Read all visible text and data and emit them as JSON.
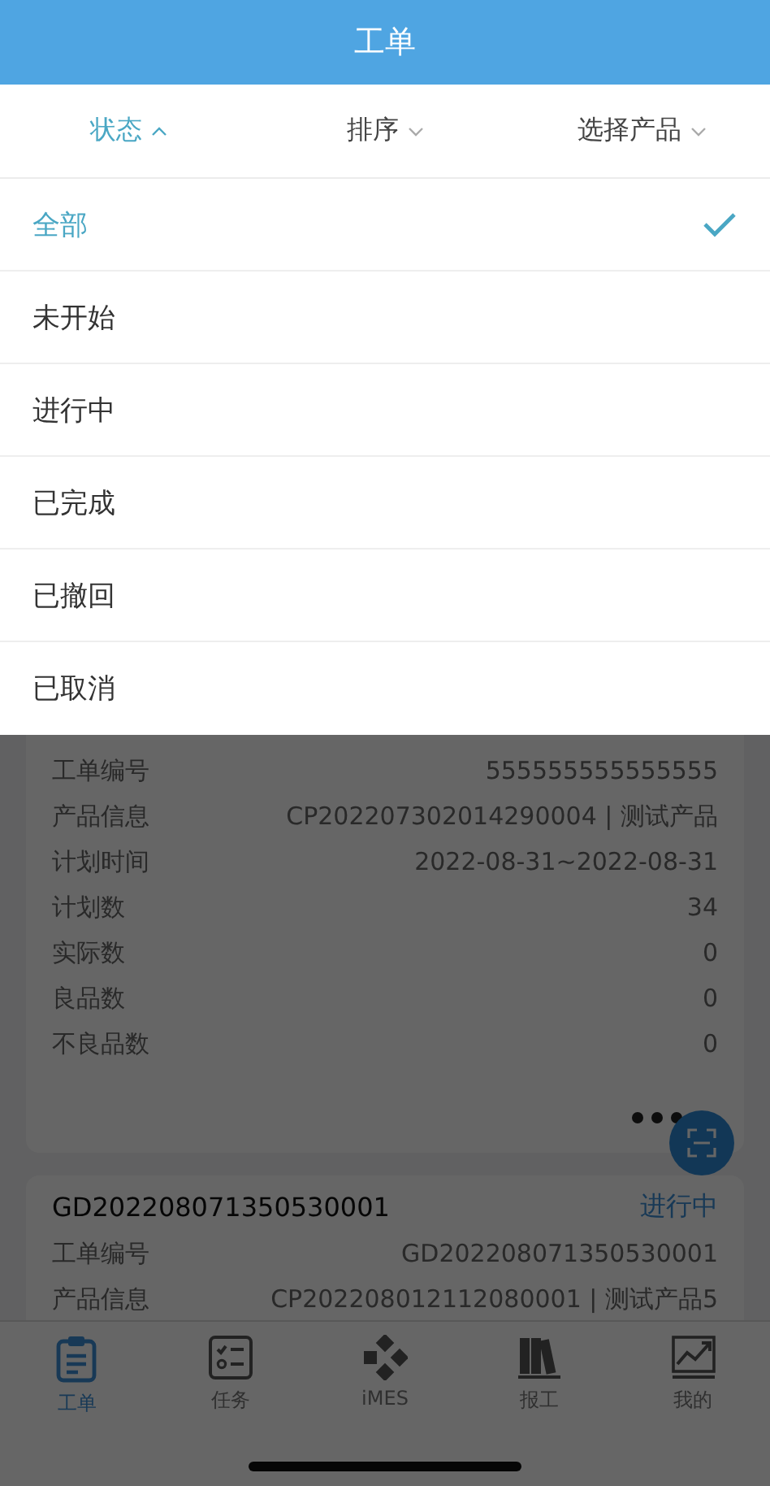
{
  "title": "工单",
  "filters": [
    {
      "label": "状态",
      "selected": true,
      "expanded": true
    },
    {
      "label": "排序",
      "selected": false,
      "expanded": false
    },
    {
      "label": "选择产品",
      "selected": false,
      "expanded": false
    }
  ],
  "status_menu": [
    {
      "label": "全部",
      "selected": true
    },
    {
      "label": "未开始",
      "selected": false
    },
    {
      "label": "进行中",
      "selected": false
    },
    {
      "label": "已完成",
      "selected": false
    },
    {
      "label": "已撤回",
      "selected": false
    },
    {
      "label": "已取消",
      "selected": false
    }
  ],
  "work_orders": [
    {
      "more_button": true,
      "fields": [
        {
          "label": "工单编号",
          "value": "555555555555555"
        },
        {
          "label": "产品信息",
          "value": "CP202207302014290004 | 测试产品"
        },
        {
          "label": "计划时间",
          "value": "2022-08-31~2022-08-31"
        },
        {
          "label": "计划数",
          "value": "34"
        },
        {
          "label": "实际数",
          "value": "0"
        },
        {
          "label": "良品数",
          "value": "0"
        },
        {
          "label": "不良品数",
          "value": "0"
        }
      ]
    },
    {
      "title": "GD202208071350530001",
      "status": "进行中",
      "fields": [
        {
          "label": "工单编号",
          "value": "GD202208071350530001"
        },
        {
          "label": "产品信息",
          "value": "CP202208012112080001 | 测试产品5"
        }
      ]
    }
  ],
  "tab_bar": [
    {
      "label": "工单",
      "selected": true
    },
    {
      "label": "任务",
      "selected": false
    },
    {
      "label": "iMES",
      "selected": false
    },
    {
      "label": "报工",
      "selected": false
    },
    {
      "label": "我的",
      "selected": false
    }
  ]
}
